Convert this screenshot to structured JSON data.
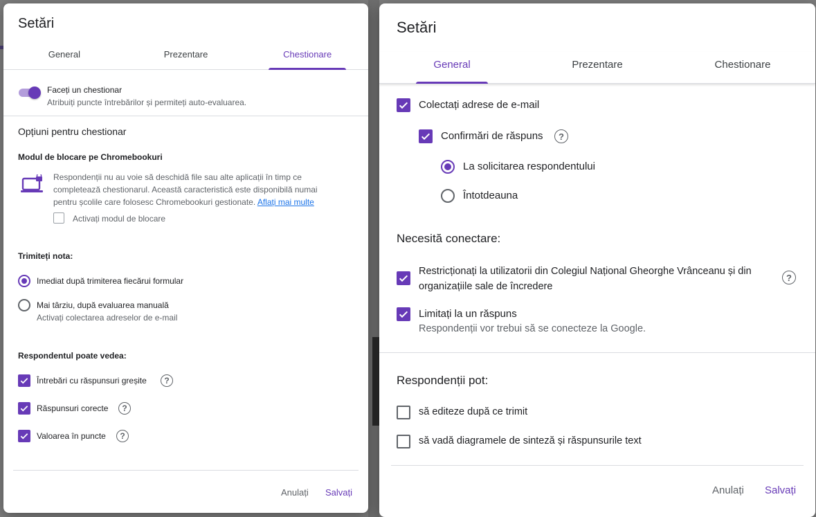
{
  "left_dialog": {
    "title": "Setări",
    "tabs": [
      "General",
      "Prezentare",
      "Chestionare"
    ],
    "quiz_toggle": {
      "label": "Faceți un chestionar",
      "description": "Atribuiți puncte întrebărilor și permiteți auto-evaluarea.",
      "on": true
    },
    "section_title": "Opțiuni pentru chestionar",
    "lockdown": {
      "heading": "Modul de blocare pe Chromebookuri",
      "line1": "Respondenții nu au voie să deschidă file sau alte aplicații în timp ce",
      "line2": "completează chestionarul. Această caracteristică este disponibilă numai",
      "line3": "pentru școlile care folosesc Chromebookuri gestionate.",
      "link": "Aflați mai multe",
      "checkbox_label": "Activați modul de blocare"
    },
    "release_grade": {
      "heading": "Trimiteți nota:",
      "option1": "Imediat după trimiterea fiecărui formular",
      "option2": "Mai târziu, după evaluarea manuală",
      "option2_sub": "Activați colectarea adreselor de e-mail"
    },
    "respondent_can_see": {
      "heading": "Respondentul poate vedea:",
      "items": [
        "Întrebări cu răspunsuri greșite",
        "Răspunsuri corecte",
        "Valoarea în puncte"
      ]
    },
    "cancel": "Anulați",
    "save": "Salvați"
  },
  "right_dialog": {
    "title": "Setări",
    "tabs": [
      "General",
      "Prezentare",
      "Chestionare"
    ],
    "collect_emails": "Colectați adrese de e-mail",
    "response_receipts": "Confirmări de răspuns",
    "receipt_option1": "La solicitarea respondentului",
    "receipt_option2": "Întotdeauna",
    "requires_signin": "Necesită conectare:",
    "restrict_line1": "Restricționați la utilizatorii din Colegiul Național Gheorghe Vrânceanu și din",
    "restrict_line2": "organizațiile sale de încredere",
    "limit_one": "Limitați la un răspuns",
    "limit_one_sub": "Respondenții vor trebui să se conecteze la Google.",
    "respondents_can": "Respondenții pot:",
    "edit_after": "să editeze după ce trimit",
    "see_summary": "să vadă diagramele de sinteză și răspunsurile text",
    "cancel": "Anulați",
    "save": "Salvați"
  },
  "colors": {
    "accent": "#673ab7",
    "link": "#1a73e8"
  }
}
